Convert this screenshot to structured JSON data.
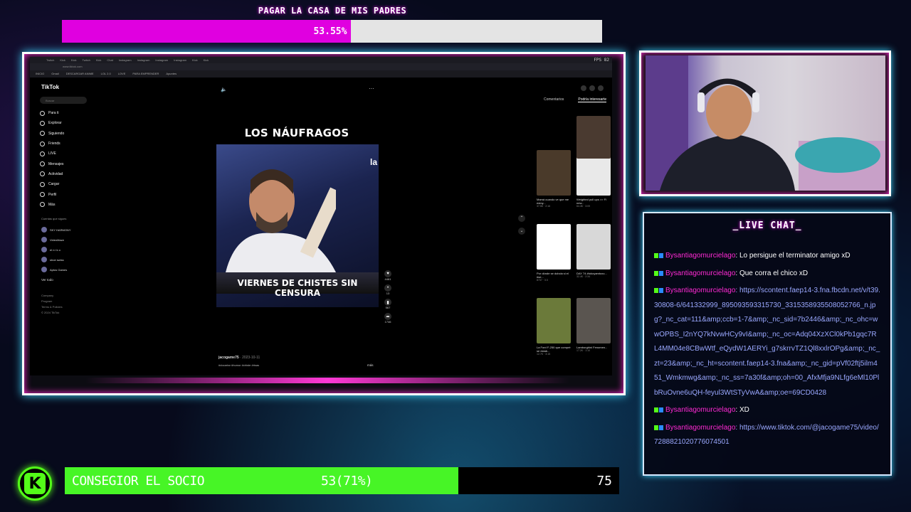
{
  "top_goal": {
    "title": "PAGAR LA CASA DE MIS PADRES",
    "percent_text": "53.55%",
    "progress": 0.5355
  },
  "browser": {
    "tabs": [
      "Twitch",
      "Kick",
      "Kick",
      "Twitch",
      "Kick",
      "Chat",
      "Instagram",
      "Instagram",
      "Instagram",
      "Instagram",
      "Kick",
      "Kick"
    ],
    "hud": "FPS 82",
    "bookmarks": [
      "INICIO",
      "Gmail",
      "DESCARGAR ANIME",
      "LOL 2.0",
      "LOVE",
      "PARA EMPRENDER",
      "Apuntes"
    ]
  },
  "tiktok": {
    "logo": "TikTok",
    "search_placeholder": "Buscar",
    "nav": [
      "Para ti",
      "Explorar",
      "Siguiendo",
      "Friends",
      "LIVE",
      "Mensajes",
      "Actividad",
      "Cargar",
      "Perfil",
      "Más"
    ],
    "following_title": "Cuentas que sigues",
    "following": [
      "SKY HARMONY",
      "VideoMaze",
      "el n i k o",
      "shoe swiss",
      "Aptos Games"
    ],
    "see_all": "Ver todo",
    "footer": [
      "Company",
      "Program",
      "Terms & Policies",
      "© 2024 TikTok"
    ],
    "video_title": "LOS NÁUFRAGOS",
    "tv_logo": "la",
    "caption": "VIERNES DE CHISTES SIN CENSURA",
    "author": "jacogame75",
    "date": "· 2023-10-11",
    "description": "#docartar #humor #chiste #risas",
    "more": "más",
    "actions": [
      {
        "icon": "heart-icon",
        "glyph": "♥",
        "count": "4461"
      },
      {
        "icon": "comment-icon",
        "glyph": "•",
        "count": "13"
      },
      {
        "icon": "bookmark-icon",
        "glyph": "▮",
        "count": "567"
      },
      {
        "icon": "share-icon",
        "glyph": "➦",
        "count": "1746"
      }
    ],
    "right_tabs": [
      "Comentarios",
      "Podría interesarte"
    ],
    "cards": [
      {
        "title": "Mamá cuando ve que me estoy...",
        "meta": "37.5K · 2:16"
      },
      {
        "title": "Weighted pull ups >> Fl new...",
        "meta": "64.4K · 3:09"
      },
      {
        "title": "Por dónde se dobcla si el #se...",
        "meta": "8737 · 3:3"
      },
      {
        "title": "DAY 74 #tokoyamtoxo...",
        "meta": "32.4K · 2:34"
      },
      {
        "title": "La Ford F-250 que compré se estab...",
        "meta": "12.7K · 3:15"
      },
      {
        "title": "Lamborghini Fenomen...",
        "meta": "17.2K · 1:10"
      }
    ]
  },
  "chat": {
    "title": "_LIVE CHAT_",
    "messages": [
      {
        "user": "Bysantiagomurcielago",
        "text": ": Lo persigue el terminator amigo xD",
        "is_link": false
      },
      {
        "user": "Bysantiagomurcielago",
        "text": ": Que corra el chico xD",
        "is_link": false
      },
      {
        "user": "Bysantiagomurcielago",
        "text": ": https://scontent.faep14-3.fna.fbcdn.net/v/t39.30808-6/641332999_895093593315730_3315358935508052766_n.jpg?_nc_cat=111&amp;ccb=1-7&amp;_nc_sid=7b2446&amp;_nc_ohc=wwOPBS_I2nYQ7kNvwHCy9vI&amp;_nc_oc=Adq04XzXCl0kPb1gqc7RL4MM04e8CBwWtf_eQydW1AERYi_g7skrrvTZ1Ql8xxlrOPg&amp;_nc_zt=23&amp;_nc_ht=scontent.faep14-3.fna&amp;_nc_gid=pVf02ftj5ilm451_Wmkmwg&amp;_nc_ss=7a30f&amp;oh=00_AfxMfja9NLfg6eMl10PlbRuOvne6uQH-feyul3WtSTyVwA&amp;oe=69CD0428",
        "is_link": true
      },
      {
        "user": "Bysantiagomurcielago",
        "text": ": XD",
        "is_link": false
      },
      {
        "user": "Bysantiagomurcielago",
        "text": ": https://www.tiktok.com/@jacogame75/video/7288821020776074501",
        "is_link": true
      }
    ]
  },
  "sub_goal": {
    "label": "CONSEGIOR EL SOCIO",
    "progress_text": "53(71%)",
    "target": "75",
    "progress": 0.71
  },
  "colors": {
    "magenta": "#e000e0",
    "green": "#47f526",
    "cyan_glow": "#3fd7ff"
  }
}
